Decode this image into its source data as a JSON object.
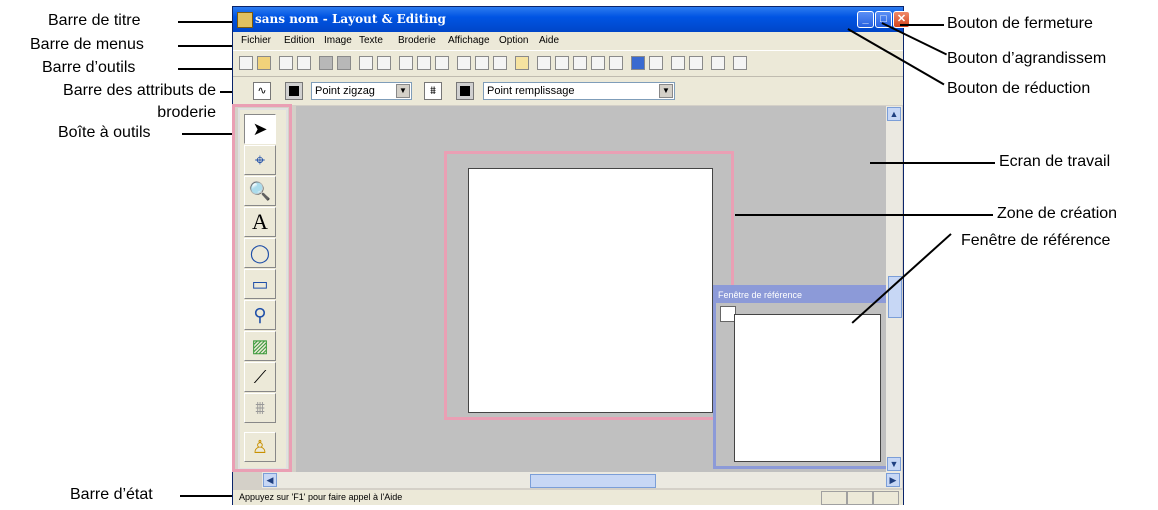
{
  "window": {
    "title": "sans nom - Layout & Editing",
    "minimize_glyph": "_",
    "maximize_glyph": "□",
    "close_glyph": "✕"
  },
  "menus": [
    "Fichier",
    "Edition",
    "Image",
    "Texte",
    "Broderie",
    "Affichage",
    "Option",
    "Aide"
  ],
  "attribute_bar": {
    "line_icon": "∿",
    "line_sew_type": "Point zigzag",
    "fill_icon": "⩩",
    "fill_sew_type": "Point remplissage"
  },
  "tools": [
    {
      "icon": "arrow-select-icon",
      "glyph": "➤"
    },
    {
      "icon": "point-edit-icon",
      "glyph": "⌖"
    },
    {
      "icon": "zoom-icon",
      "glyph": "🔍"
    },
    {
      "icon": "text-icon",
      "glyph": "A"
    },
    {
      "icon": "circle-icon",
      "glyph": "◯"
    },
    {
      "icon": "rectangle-icon",
      "glyph": "▭"
    },
    {
      "icon": "shape-icon",
      "glyph": "⚲"
    },
    {
      "icon": "fill-icon",
      "glyph": "▨"
    },
    {
      "icon": "measure-icon",
      "glyph": "⟋"
    },
    {
      "icon": "stitch-icon",
      "glyph": "⩩"
    },
    {
      "icon": "stamp-icon",
      "glyph": "♙"
    }
  ],
  "reference_window": {
    "title": "Fenêtre de référence"
  },
  "status_text": "Appuyez sur 'F1' pour faire appel à l'Aide",
  "annotations": {
    "title_bar": "Barre de titre",
    "menu_bar": "Barre de menus",
    "toolbar": "Barre d’outils",
    "attr_bar_line1": "Barre des attributs de",
    "attr_bar_line2": "broderie",
    "toolbox": "Boîte à outils",
    "status_bar": "Barre d’état",
    "close_button": "Bouton de fermeture",
    "maximize_button": "Bouton d’agrandissem",
    "minimize_button": "Bouton de réduction",
    "work_screen": "Ecran de travail",
    "design_area": "Zone de création",
    "reference_window": "Fenêtre de référence"
  },
  "colors": {
    "highlight": "#ea9fb4",
    "titlebar": "#0054e3"
  }
}
